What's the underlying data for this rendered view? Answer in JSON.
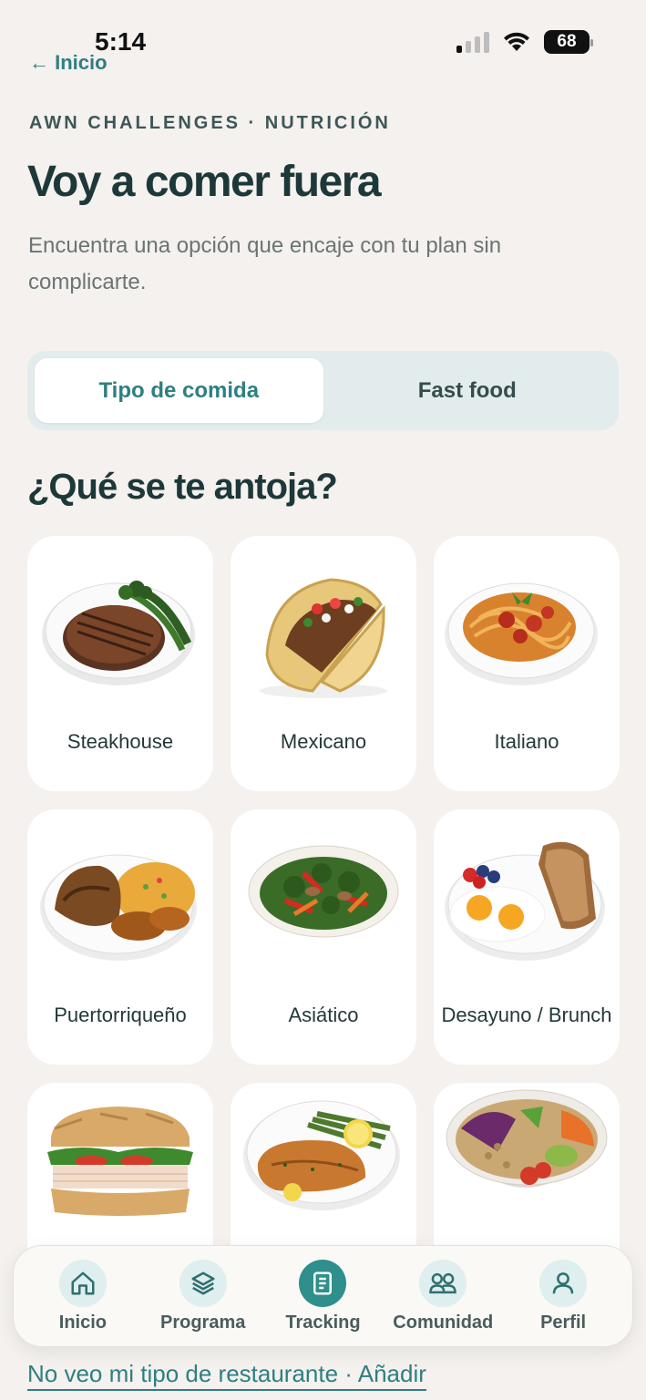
{
  "status": {
    "time": "5:14",
    "battery": "68"
  },
  "header": {
    "back_label": "← Inicio",
    "eyebrow": "AWN CHALLENGES · NUTRICIÓN",
    "title": "Voy a comer fuera",
    "subtitle": "Encuentra una opción que encaje con tu plan sin complicarte."
  },
  "segmented": {
    "tabs": [
      "Tipo de comida",
      "Fast food"
    ],
    "selected": "Tipo de comida"
  },
  "section_title": "¿Qué se te antoja?",
  "categories": [
    {
      "label": "Steakhouse",
      "icon": "steak-plate"
    },
    {
      "label": "Mexicano",
      "icon": "taco"
    },
    {
      "label": "Italiano",
      "icon": "spaghetti-plate"
    },
    {
      "label": "Puertorriqueño",
      "icon": "chicken-rice-plantain"
    },
    {
      "label": "Asiático",
      "icon": "stir-fry-bowl"
    },
    {
      "label": "Desayuno / Brunch",
      "icon": "eggs-toast-plate"
    },
    {
      "label": "",
      "icon": "sandwich"
    },
    {
      "label": "",
      "icon": "salmon-asparagus-plate"
    },
    {
      "label": "",
      "icon": "grain-bowl"
    }
  ],
  "bottom_nav": [
    {
      "label": "Inicio",
      "icon": "home-icon"
    },
    {
      "label": "Programa",
      "icon": "layers-icon"
    },
    {
      "label": "Tracking",
      "icon": "clipboard-icon",
      "active": true
    },
    {
      "label": "Comunidad",
      "icon": "people-icon"
    },
    {
      "label": "Perfil",
      "icon": "user-icon"
    }
  ],
  "footer_link": "No veo mi tipo de restaurante · Añadir",
  "colors": {
    "accent": "#2f7f80",
    "background": "#f4f1ee",
    "active_nav": "#2f8f8c"
  }
}
